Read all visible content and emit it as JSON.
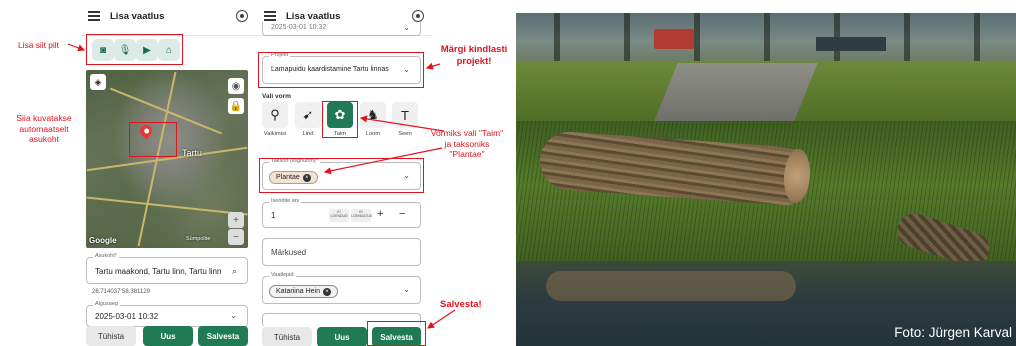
{
  "app": {
    "title": "Lisa vaatlus"
  },
  "annotations": {
    "add_here": "Lisa siit pilt",
    "location_auto_line1": "Siia kuvatakse",
    "location_auto_line2": "automaatselt",
    "location_auto_line3": "asukoht",
    "mark_project_line1": "Märgi kindlasti",
    "mark_project_line2": "projekt!",
    "form_taxon_line1": "Vormiks vali \"Taim\"",
    "form_taxon_line2": "ja taksoniks",
    "form_taxon_line3": "\"Plantae\"",
    "save": "Salvesta!"
  },
  "left_panel": {
    "media_buttons": [
      {
        "icon": "camera-icon",
        "glyph": "📷"
      },
      {
        "icon": "microphone-icon",
        "glyph": "🎤"
      },
      {
        "icon": "video-icon",
        "glyph": "🎥"
      },
      {
        "icon": "attachment-icon",
        "glyph": "📎"
      }
    ],
    "map": {
      "city_label": "Tartu",
      "attribution": "Google",
      "scale_label": "Sümpolite",
      "zoom_in": "+",
      "zoom_out": "−"
    },
    "location": {
      "label": "Asukoht*",
      "value": "Tartu maakond, Tartu linn, Tartu linn",
      "coords": "26.714037 58.381129"
    },
    "start_time": {
      "label": "Algusaeg",
      "value": "2025-03-01 10:32"
    },
    "buttons": {
      "cancel": "Tühista",
      "new": "Uus",
      "save": "Salvesta"
    }
  },
  "right_panel": {
    "top_field_value": "2025-03-01 10:32",
    "project": {
      "label": "Projekt",
      "value": "Lamapuidu kaardistamine Tartu linnas"
    },
    "form_heading": "Vali vorm",
    "forms": [
      {
        "label": "Vaikimisi",
        "glyph": "🔭"
      },
      {
        "label": "Lind",
        "glyph": "🐦"
      },
      {
        "label": "Taim",
        "glyph": "🌿"
      },
      {
        "label": "Loom",
        "glyph": "🐾"
      },
      {
        "label": "Seen",
        "glyph": "🍄"
      }
    ],
    "taxon": {
      "label": "Takson (lisgnühm)*",
      "chip": "Plantae"
    },
    "count": {
      "label": "Isendite arv",
      "value": "1",
      "not_counted": "EI LOENDUD",
      "not_counted_b": "EI LOENDATUD",
      "plus": "+",
      "minus": "−"
    },
    "notes_placeholder": "Märkused",
    "observers": {
      "label": "Vaatlejad",
      "chip": "Katariina Hein"
    },
    "buttons": {
      "cancel": "Tühista",
      "new": "Uus",
      "save": "Salvesta"
    }
  },
  "photo": {
    "credit": "Foto: Jürgen Karval"
  },
  "colors": {
    "accent_green": "#1f7a55",
    "annotation_red": "#e0141e"
  }
}
